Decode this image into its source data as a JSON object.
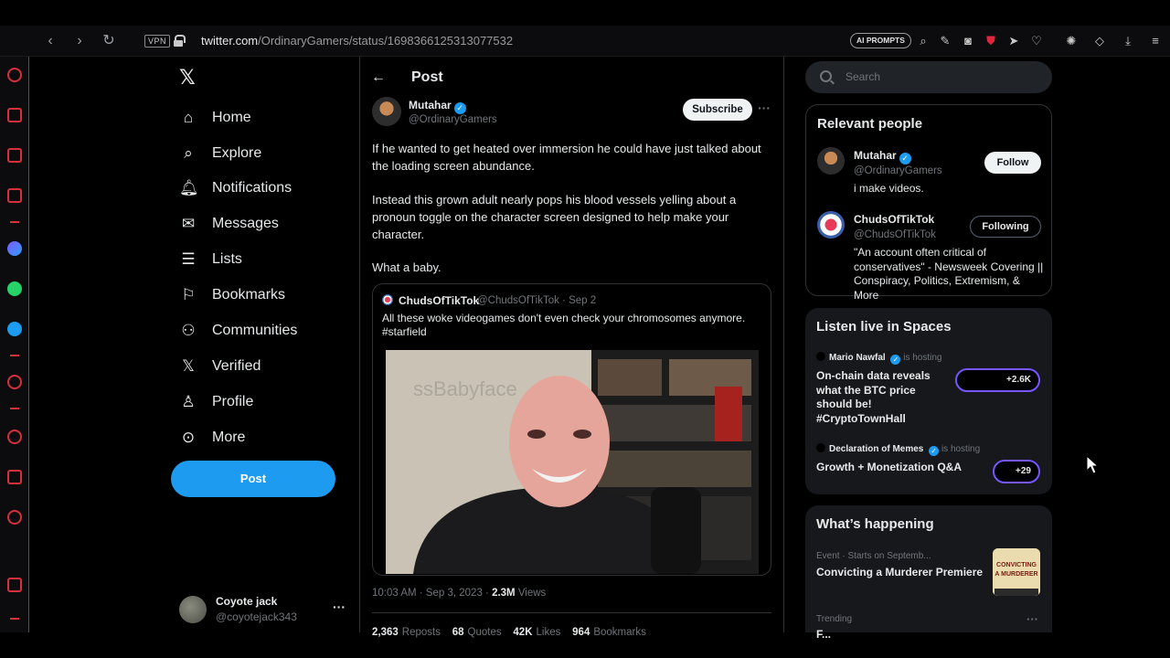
{
  "browser": {
    "vpn_label": "VPN",
    "url_host": "twitter.com",
    "url_path": "/OrdinaryGamers/status/1698366125313077532",
    "ai_prompts_label": "AI PROMPTS"
  },
  "nav": {
    "items": [
      {
        "label": "Home",
        "icon": "home-icon"
      },
      {
        "label": "Explore",
        "icon": "search-icon"
      },
      {
        "label": "Notifications",
        "icon": "bell-icon"
      },
      {
        "label": "Messages",
        "icon": "envelope-icon"
      },
      {
        "label": "Lists",
        "icon": "list-icon"
      },
      {
        "label": "Bookmarks",
        "icon": "bookmark-icon"
      },
      {
        "label": "Communities",
        "icon": "people-icon"
      },
      {
        "label": "Verified",
        "icon": "x-logo-icon"
      },
      {
        "label": "Profile",
        "icon": "person-icon"
      },
      {
        "label": "More",
        "icon": "more-circle-icon"
      }
    ],
    "post_button": "Post"
  },
  "account": {
    "name": "Coyote jack",
    "handle": "@coyotejack343"
  },
  "post": {
    "header": "Post",
    "author_name": "Mutahar",
    "author_handle": "@OrdinaryGamers",
    "subscribe_label": "Subscribe",
    "paragraphs": [
      "If he wanted to get heated over immersion he could have just talked about the loading screen abundance.",
      "Instead this grown adult nearly pops his blood vessels yelling about a pronoun toggle on the character screen designed to help make your character.",
      "What a baby."
    ],
    "quote": {
      "name": "ChudsOfTikTok",
      "handle_date": "@ChudsOfTikTok · Sep 2",
      "text": "All these woke videogames don't even check your chromosomes anymore. #starfield"
    },
    "time": "10:03 AM · Sep 3, 2023 · ",
    "views_count": "2.3M",
    "views_label": "Views",
    "stats": [
      {
        "count": "2,363",
        "label": "Reposts"
      },
      {
        "count": "68",
        "label": "Quotes"
      },
      {
        "count": "42K",
        "label": "Likes"
      },
      {
        "count": "964",
        "label": "Bookmarks"
      }
    ]
  },
  "right": {
    "search_placeholder": "Search",
    "relevant": {
      "title": "Relevant people",
      "people": [
        {
          "name": "Mutahar",
          "handle": "@OrdinaryGamers",
          "bio": "i make videos.",
          "button": "Follow"
        },
        {
          "name": "ChudsOfTikTok",
          "handle": "@ChudsOfTikTok",
          "bio": "\"An account often critical of conservatives\" - Newsweek Covering || Conspiracy, Politics, Extremism, & More",
          "button": "Following"
        }
      ]
    },
    "spaces": {
      "title": "Listen live in Spaces",
      "items": [
        {
          "host": "Mario Nawfal",
          "hosting": "is hosting",
          "title": "On-chain data reveals what the BTC price should be! #CryptoTownHall",
          "count": "+2.6K"
        },
        {
          "host": "Declaration of Memes",
          "hosting": "is hosting",
          "title": "Growth + Monetization Q&A",
          "count": "+29"
        }
      ]
    },
    "happening": {
      "title": "What’s happening",
      "items": [
        {
          "meta": "Event · Starts on Septemb...",
          "title": "Convicting a Murderer Premiere",
          "thumb_text": "CONVICTING A MURDERER"
        },
        {
          "meta": "Trending",
          "title": "F..."
        }
      ]
    }
  },
  "colors": {
    "accent": "#1d9bf0",
    "opera_red": "#d11b2a",
    "spaces_purple": "#7856ff"
  }
}
